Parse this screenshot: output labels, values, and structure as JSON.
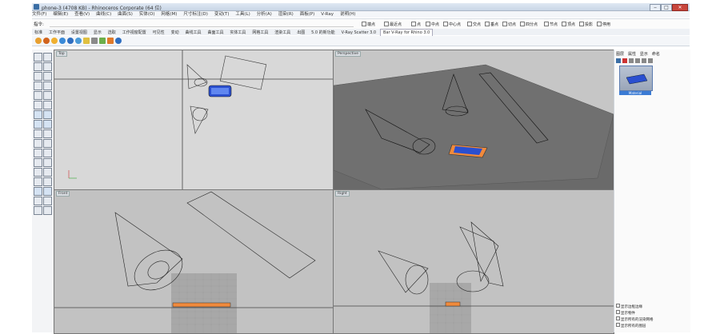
{
  "window": {
    "title": "phone-3 (4708 KB) - Rhinoceros Corporate (64 位)",
    "buttons": [
      "‒",
      "□",
      "✕"
    ]
  },
  "menubar": {
    "items": [
      "文件(F)",
      "编辑(E)",
      "查看(V)",
      "曲线(C)",
      "曲面(S)",
      "实体(O)",
      "网格(M)",
      "尺寸标注(D)",
      "变动(T)",
      "工具(L)",
      "分析(A)",
      "渲染(R)",
      "面板(P)",
      "V-Ray",
      "说明(H)"
    ]
  },
  "command": {
    "label": "指令:",
    "osnaps": [
      "端点",
      "最近点",
      "点",
      "中点",
      "中心点",
      "交点",
      "垂点",
      "切点",
      "四分点",
      "节点",
      "顶点",
      "投影",
      "停用"
    ]
  },
  "tabs": {
    "items": [
      "标准",
      "工作平面",
      "设置视图",
      "显示",
      "选取",
      "工作视窗配置",
      "可见性",
      "变动",
      "曲线工具",
      "曲面工具",
      "实体工具",
      "网格工具",
      "渲染工具",
      "出图",
      "5.0 的新功能",
      "V-Ray Scatter 3.0",
      "Bar V-Ray for Rhino 3.0"
    ],
    "active_index": 16
  },
  "viewports": {
    "top": "Top",
    "perspective": "Perspective",
    "front": "Front",
    "right": "Right"
  },
  "right_panel": {
    "tabs": [
      "图层",
      "属性",
      "显示",
      "命名"
    ],
    "thumbnail_caption": "Material"
  },
  "options": {
    "items": [
      "显示边框边缘",
      "显示物件",
      "显示所有的渲染网格",
      "显示所有的图层"
    ]
  },
  "colors": {
    "titlebar": "#cdd9e8",
    "viewport_bg_light": "#c4c4c4",
    "viewport_bg_dark": "#5e5e5e",
    "perspective_floor": "#6a6a6a",
    "phone_blue": "#2a4fd0",
    "phone_orange": "#f08a3c"
  }
}
